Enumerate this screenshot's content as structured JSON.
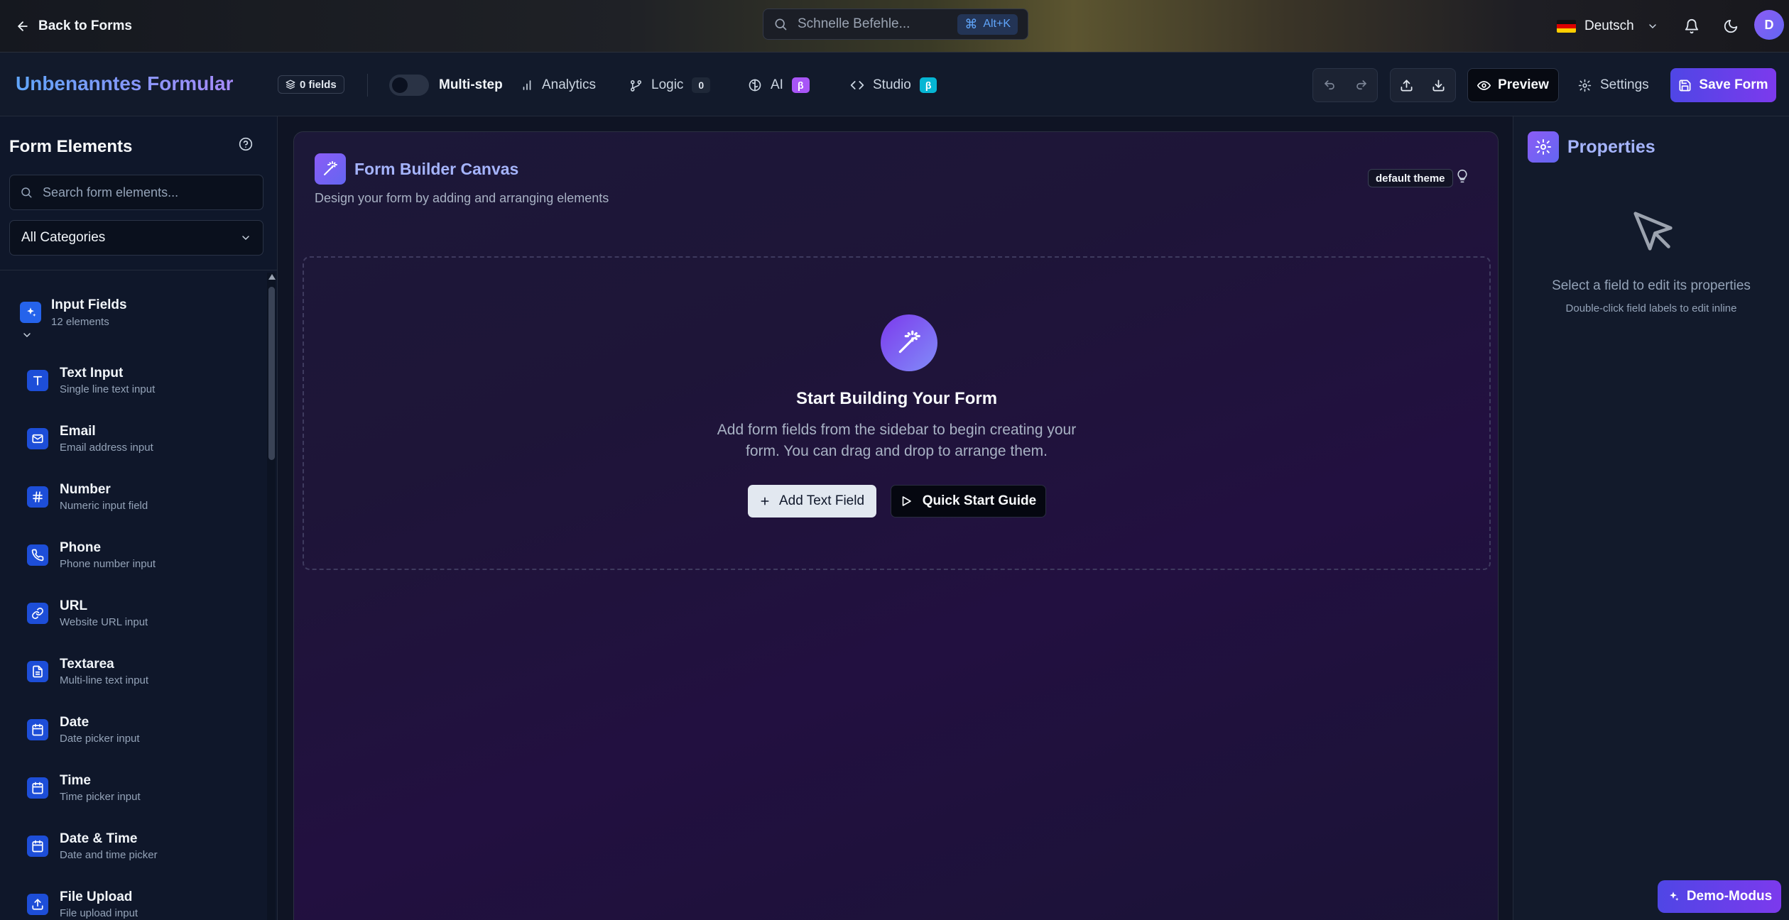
{
  "topbar": {
    "back_label": "Back to Forms",
    "search_placeholder": "Schnelle Befehle...",
    "shortcut": "Alt+K",
    "language": "Deutsch",
    "avatar_initial": "D"
  },
  "toolbar": {
    "form_title": "Unbenanntes Formular",
    "fields_count": "0 fields",
    "multistep_label": "Multi-step",
    "analytics_label": "Analytics",
    "logic_label": "Logic",
    "logic_count": "0",
    "ai_label": "AI",
    "ai_badge": "β",
    "studio_label": "Studio",
    "studio_badge": "β",
    "preview_label": "Preview",
    "settings_label": "Settings",
    "save_label": "Save Form"
  },
  "sidebar": {
    "title": "Form Elements",
    "search_placeholder": "Search form elements...",
    "category_select": "All Categories",
    "category": {
      "name": "Input Fields",
      "count": "12 elements"
    },
    "items": [
      {
        "name": "Text Input",
        "desc": "Single line text input",
        "icon": "text-icon"
      },
      {
        "name": "Email",
        "desc": "Email address input",
        "icon": "mail-icon"
      },
      {
        "name": "Number",
        "desc": "Numeric input field",
        "icon": "hash-icon"
      },
      {
        "name": "Phone",
        "desc": "Phone number input",
        "icon": "phone-icon"
      },
      {
        "name": "URL",
        "desc": "Website URL input",
        "icon": "link-icon"
      },
      {
        "name": "Textarea",
        "desc": "Multi-line text input",
        "icon": "file-text-icon"
      },
      {
        "name": "Date",
        "desc": "Date picker input",
        "icon": "calendar-icon"
      },
      {
        "name": "Time",
        "desc": "Time picker input",
        "icon": "calendar-icon"
      },
      {
        "name": "Date & Time",
        "desc": "Date and time picker",
        "icon": "calendar-icon"
      },
      {
        "name": "File Upload",
        "desc": "File upload input",
        "icon": "upload-icon"
      }
    ]
  },
  "canvas": {
    "title": "Form Builder Canvas",
    "subtitle": "Design your form by adding and arranging elements",
    "theme_badge": "default theme",
    "empty_title": "Start Building Your Form",
    "empty_text_line1": "Add form fields from the sidebar to begin creating your",
    "empty_text_line2": "form. You can drag and drop to arrange them.",
    "add_text_field": "Add Text Field",
    "quick_start": "Quick Start Guide"
  },
  "properties": {
    "title": "Properties",
    "message": "Select a field to edit its properties",
    "hint": "Double-click field labels to edit inline"
  },
  "demo_label": "Demo-Modus",
  "colors": {
    "accent": "#6366f1",
    "beta_ai": "#a855f7",
    "beta_studio": "#06b6d4",
    "element_icon": "#2563eb"
  }
}
